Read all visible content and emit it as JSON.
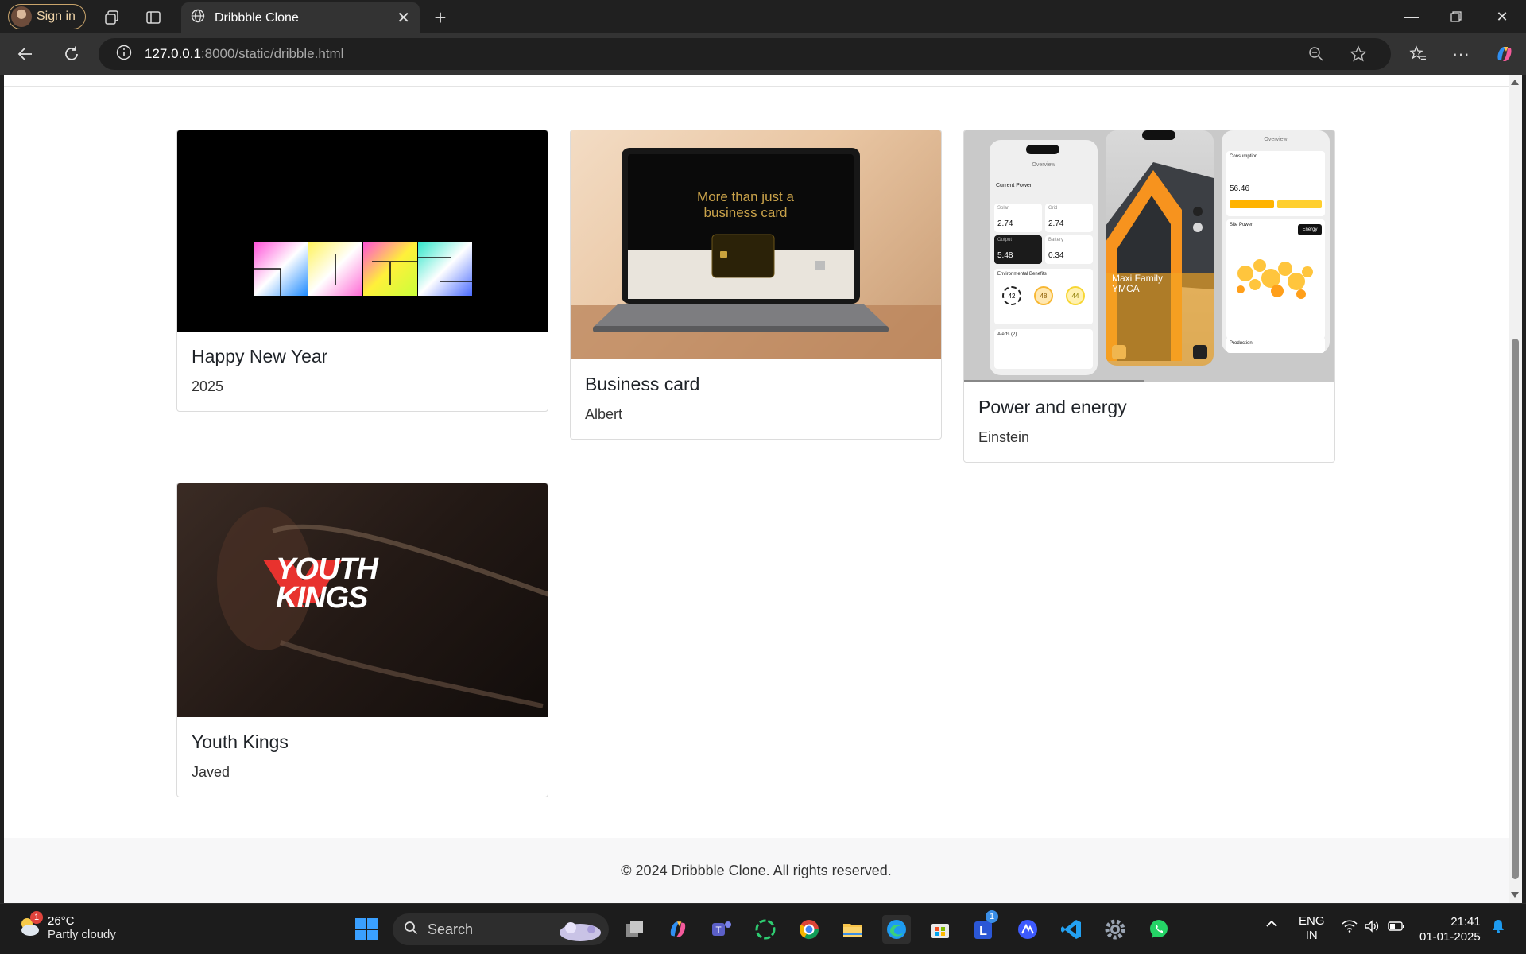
{
  "browser": {
    "profile_label": "Sign in",
    "tab_title": "Dribbble Clone",
    "url_host": "127.0.0.1",
    "url_rest": ":8000/static/dribble.html"
  },
  "shots": [
    {
      "title": "Happy New Year",
      "author": "2025"
    },
    {
      "title": "Business card",
      "author": "Albert"
    },
    {
      "title": "Power and energy",
      "author": "Einstein"
    },
    {
      "title": "Youth Kings",
      "author": "Javed"
    }
  ],
  "shot_images": {
    "business_card_headline_1": "More than just a",
    "business_card_headline_2": "business card",
    "energy_app_building": "Maxi Family",
    "energy_app_building_2": "YMCA",
    "energy_overview": "Overview",
    "energy_current_power": "Current Power",
    "energy_consumption": "Consumption",
    "energy_consumption_value": "56.46",
    "energy_solar_label": "Solar",
    "energy_grid_label": "Grid",
    "energy_output_label": "Output",
    "energy_battery_label": "Battery",
    "energy_solar": "2.74",
    "energy_grid": "2.74",
    "energy_output": "5.48",
    "energy_battery": "0.34",
    "energy_env_benefits": "Environmental Benefits",
    "energy_benefit_1": "42",
    "energy_benefit_2": "48",
    "energy_benefit_3": "44",
    "energy_alerts": "Alerts (2)",
    "energy_site_power": "Site Power",
    "energy_energy_btn": "Energy",
    "energy_production": "Production",
    "youth_kings_line1": "YOUTH",
    "youth_kings_line2": "KINGS"
  },
  "footer": {
    "text": "© 2024 Dribbble Clone. All rights reserved."
  },
  "taskbar": {
    "weather_temp": "26°C",
    "weather_desc": "Partly cloudy",
    "weather_badge": "1",
    "search_label": "Search",
    "lang_1": "ENG",
    "lang_2": "IN",
    "time": "21:41",
    "date": "01-01-2025",
    "teams_badge": "1"
  },
  "colors": {
    "accent_orange": "#f7931e",
    "yk_red": "#e8322e",
    "edge_blue": "#1d9bf0"
  }
}
